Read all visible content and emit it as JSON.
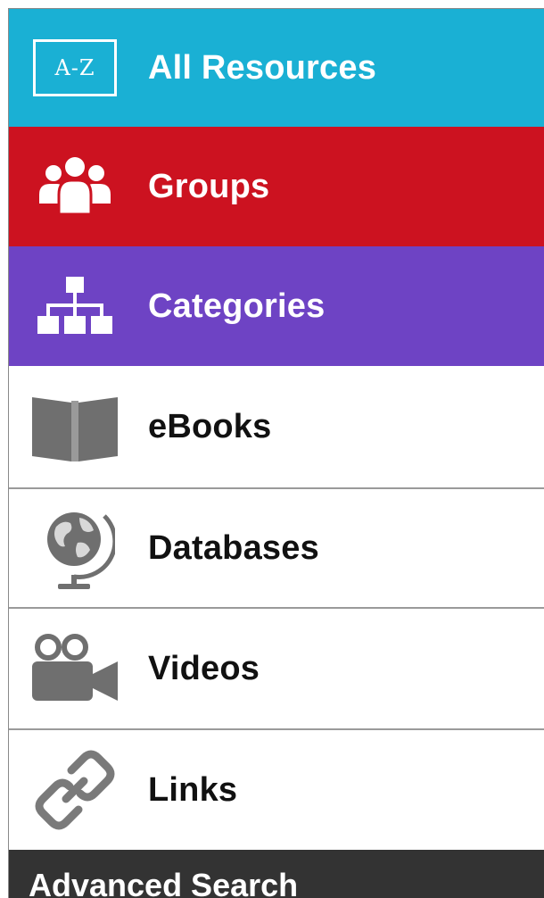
{
  "menu": {
    "items": [
      {
        "label": "All Resources",
        "icon": "a-z-icon",
        "icon_text": "A-Z",
        "color": "#1ab0d4"
      },
      {
        "label": "Groups",
        "icon": "group-icon",
        "color": "#cc1220"
      },
      {
        "label": "Categories",
        "icon": "hierarchy-icon",
        "color": "#6e43c4"
      },
      {
        "label": "eBooks",
        "icon": "book-icon"
      },
      {
        "label": "Databases",
        "icon": "globe-icon"
      },
      {
        "label": "Videos",
        "icon": "video-camera-icon"
      },
      {
        "label": "Links",
        "icon": "link-icon"
      }
    ],
    "footer": {
      "label": "Advanced Search",
      "color": "#333333"
    }
  }
}
